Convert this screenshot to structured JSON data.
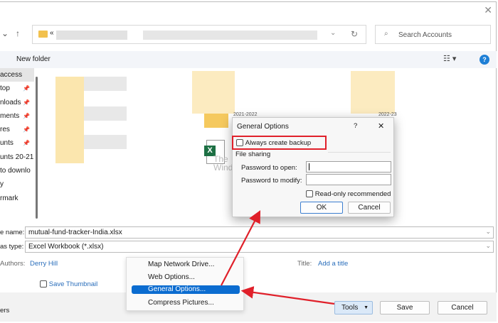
{
  "window": {
    "close_icon": "close-icon"
  },
  "address": {
    "prefix": "«",
    "refresh_icon": "refresh-icon"
  },
  "search": {
    "placeholder": "Search Accounts"
  },
  "toolbar": {
    "new_folder": "New folder",
    "help": "?"
  },
  "sidebar": {
    "items": [
      {
        "label": "access",
        "selected": true
      },
      {
        "label": "top",
        "pinned": true
      },
      {
        "label": "nloads",
        "pinned": true
      },
      {
        "label": "ments",
        "pinned": true
      },
      {
        "label": "res",
        "pinned": true
      },
      {
        "label": "unts",
        "pinned": true
      },
      {
        "label": "unts 20-21"
      },
      {
        "label": "to downlo"
      },
      {
        "label": "y"
      },
      {
        "label": "rmark"
      }
    ]
  },
  "content": {
    "folder_label_1": "2021-2022",
    "folder_label_2": "2022-23",
    "watermark": "The WindowsClub"
  },
  "dialog": {
    "title": "General Options",
    "help": "?",
    "close": "✕",
    "backup": "Always create backup",
    "backup_checked": false,
    "section": "File sharing",
    "pw_open_label": "Password to open:",
    "pw_open_value": "",
    "pw_modify_label": "Password to modify:",
    "pw_modify_value": "",
    "readonly": "Read-only recommended",
    "readonly_checked": false,
    "ok": "OK",
    "cancel": "Cancel"
  },
  "form": {
    "filename_label": "e name:",
    "filename_value": "mutual-fund-tracker-India.xlsx",
    "type_label": "as type:",
    "type_value": "Excel Workbook (*.xlsx)",
    "authors_label": "Authors:",
    "authors_value": "Derry Hill",
    "title_label": "Title:",
    "title_value": "Add a title",
    "thumbnail": "Save Thumbnail",
    "hide_folders": "ers"
  },
  "tools_menu": {
    "items": [
      "Map Network Drive...",
      "Web Options...",
      "General Options...",
      "Compress Pictures..."
    ],
    "selected": "General Options..."
  },
  "buttons": {
    "tools": "Tools",
    "save": "Save",
    "cancel": "Cancel"
  },
  "colors": {
    "highlight": "#0b6cd0",
    "annotation": "#e0202a",
    "link": "#2a6ebb"
  }
}
